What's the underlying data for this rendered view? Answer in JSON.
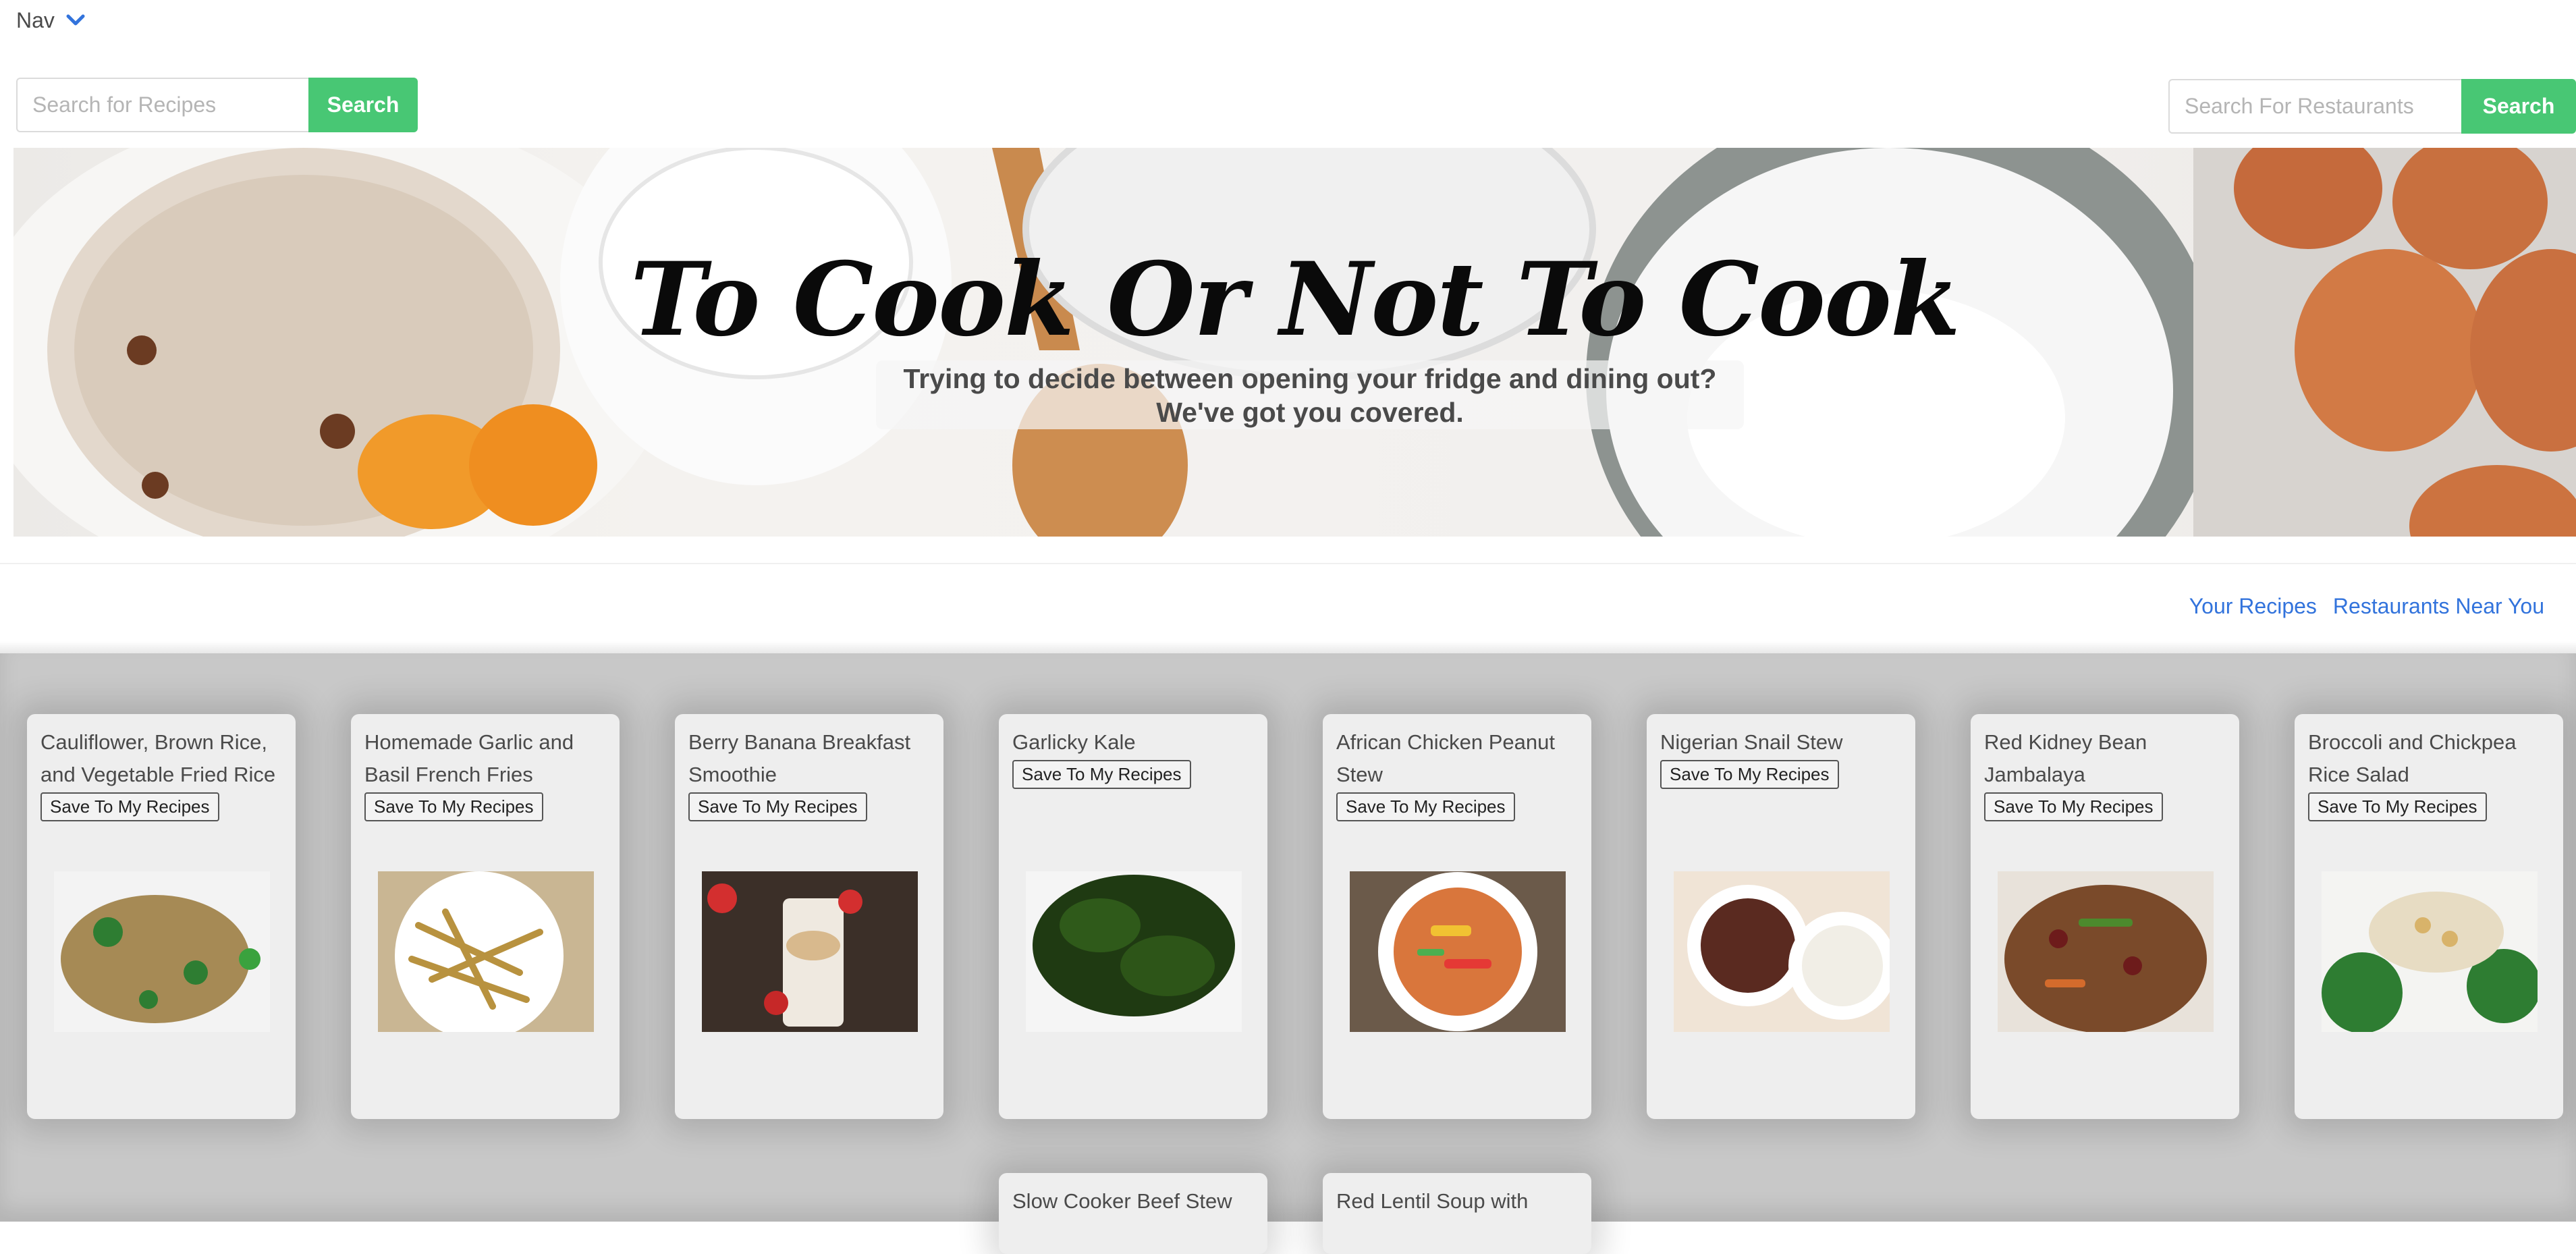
{
  "nav": {
    "label": "Nav"
  },
  "recipe_search": {
    "placeholder": "Search for Recipes",
    "button": "Search"
  },
  "restaurant_search": {
    "placeholder": "Search For Restaurants",
    "button": "Search"
  },
  "hero": {
    "title": "To Cook Or Not To Cook",
    "subtitle_line1": "Trying to decide between opening your fridge and dining out?",
    "subtitle_line2": "We've got you covered."
  },
  "tabs": {
    "your_recipes": "Your Recipes",
    "restaurants_near_you": "Restaurants Near You"
  },
  "save_label": "Save To My Recipes",
  "recipes": [
    {
      "title": "Cauliflower, Brown Rice, and Vegetable Fried Rice"
    },
    {
      "title": "Homemade Garlic and Basil French Fries"
    },
    {
      "title": "Berry Banana Breakfast Smoothie"
    },
    {
      "title": "Garlicky Kale"
    },
    {
      "title": "African Chicken Peanut Stew"
    },
    {
      "title": "Nigerian Snail Stew"
    },
    {
      "title": "Red Kidney Bean Jambalaya"
    },
    {
      "title": "Broccoli and Chickpea Rice Salad"
    },
    {
      "title": "Slow Cooker Beef Stew"
    },
    {
      "title": "Red Lentil Soup with"
    }
  ],
  "colors": {
    "accent_green": "#48c774",
    "link_blue": "#3273dc"
  }
}
